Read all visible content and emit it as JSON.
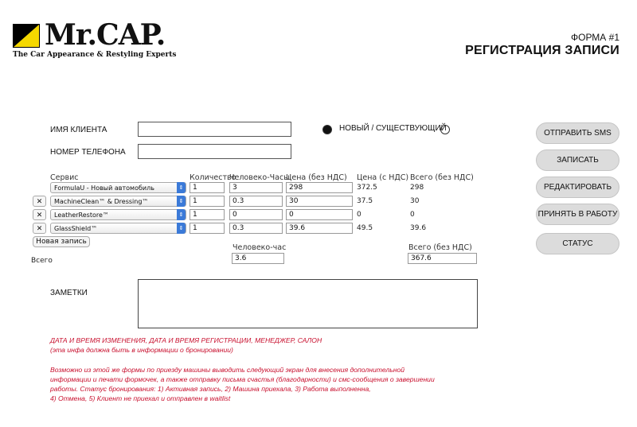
{
  "brand": {
    "name": "Mr.CAP.",
    "tagline": "The Car Appearance & Restyling Experts",
    "accent_color": "#f5d800"
  },
  "header": {
    "form_number": "ФОРМА #1",
    "title": "РЕГИСТРАЦИЯ ЗАПИСИ"
  },
  "client": {
    "name_label": "ИМЯ КЛИЕНТА",
    "name_value": "",
    "phone_label": "НОМЕР ТЕЛЕФОНА",
    "phone_value": "",
    "status_label": "НОВЫЙ / СУЩЕСТВУЮЩИЙ"
  },
  "actions": {
    "send_sms": "ОТПРАВИТЬ SMS",
    "save": "ЗАПИСАТЬ",
    "edit": "РЕДАКТИРОВАТЬ",
    "accept": "ПРИНЯТЬ В РАБОТУ",
    "status": "СТАТУС"
  },
  "services": {
    "headers": {
      "service": "Сервис",
      "quantity": "Количество",
      "man_hours": "Человеко-Часы",
      "price_no_vat": "Цена (без НДС)",
      "price_vat": "Цена (с НДС)",
      "total_no_vat": "Всего (без НДС)"
    },
    "rows": [
      {
        "service": "FormulaU - Новый автомобиль",
        "quantity": "1",
        "hours": "3",
        "price": "298",
        "price_vat": "372.5",
        "total": "298",
        "removable": false
      },
      {
        "service": "MachineClean™ & Dressing™",
        "quantity": "1",
        "hours": "0.3",
        "price": "30",
        "price_vat": "37.5",
        "total": "30",
        "removable": true
      },
      {
        "service": "LeatherRestore™",
        "quantity": "1",
        "hours": "0",
        "price": "0",
        "price_vat": "0",
        "total": "0",
        "removable": true
      },
      {
        "service": "GlassShield™",
        "quantity": "1",
        "hours": "0.3",
        "price": "39.6",
        "price_vat": "49.5",
        "total": "39.6",
        "removable": true
      }
    ],
    "remove_symbol": "✕",
    "dropdown_arrow": "⇕",
    "new_entry": "Новая запись",
    "totals": {
      "label": "Всего",
      "hours_label": "Человеко-час",
      "hours_value": "3.6",
      "sum_label": "Всего (без НДС)",
      "sum_value": "367.6"
    }
  },
  "notes": {
    "label": "ЗАМЕТКИ",
    "value": ""
  },
  "annotations": {
    "line1": "ДАТА И ВРЕМЯ ИЗМЕНЕНИЯ, ДАТА И ВРЕМЯ РЕГИСТРАЦИИ, МЕНЕДЖЕР, САЛОН",
    "line2": "(эта инфа должна быть в информации о бронировании)",
    "para": [
      "Возможно из этой же формы по приезду машины выводить следующий экран для внесения дополнительной",
      "информации и печати формочек, а также отправку письма счастья (благодарности) и смс-сообщения о завершении",
      "работы. Статус бронирования: 1) Активная запись, 2) Машина приехала, 3) Работа выполненна,",
      "4) Отмена, 5) Клиент не приехал и отправлен в waitlist"
    ],
    "color": "#c8102e"
  }
}
